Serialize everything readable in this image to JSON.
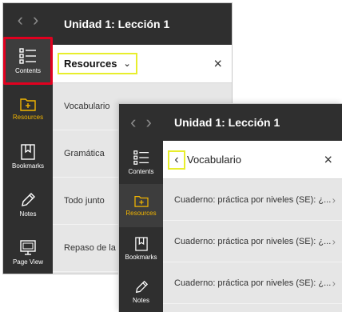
{
  "back_panel": {
    "title": "Unidad 1: Lección 1",
    "header_select": "Resources",
    "close": "×",
    "rail": [
      {
        "label": "Contents"
      },
      {
        "label": "Resources"
      },
      {
        "label": "Bookmarks"
      },
      {
        "label": "Notes"
      },
      {
        "label": "Page View"
      }
    ],
    "items": [
      "Vocabulario",
      "Gramática",
      "Todo junto",
      "Repaso de la lección"
    ]
  },
  "front_panel": {
    "title": "Unidad 1: Lección 1",
    "sub_title": "Vocabulario",
    "close": "×",
    "rail": [
      {
        "label": "Contents"
      },
      {
        "label": "Resources"
      },
      {
        "label": "Bookmarks"
      },
      {
        "label": "Notes"
      }
    ],
    "items": [
      "Cuaderno: práctica por niveles (SE): ¿...",
      "Cuaderno: práctica por niveles (SE): ¿...",
      "Cuaderno: práctica por niveles (SE): ¿..."
    ]
  },
  "colors": {
    "rail_bg": "#2f2f2f",
    "accent_gold": "#f2b500",
    "highlight_red": "#e1001f",
    "highlight_yellow": "#e8ee2c",
    "list_bg": "#e6e6e6"
  }
}
